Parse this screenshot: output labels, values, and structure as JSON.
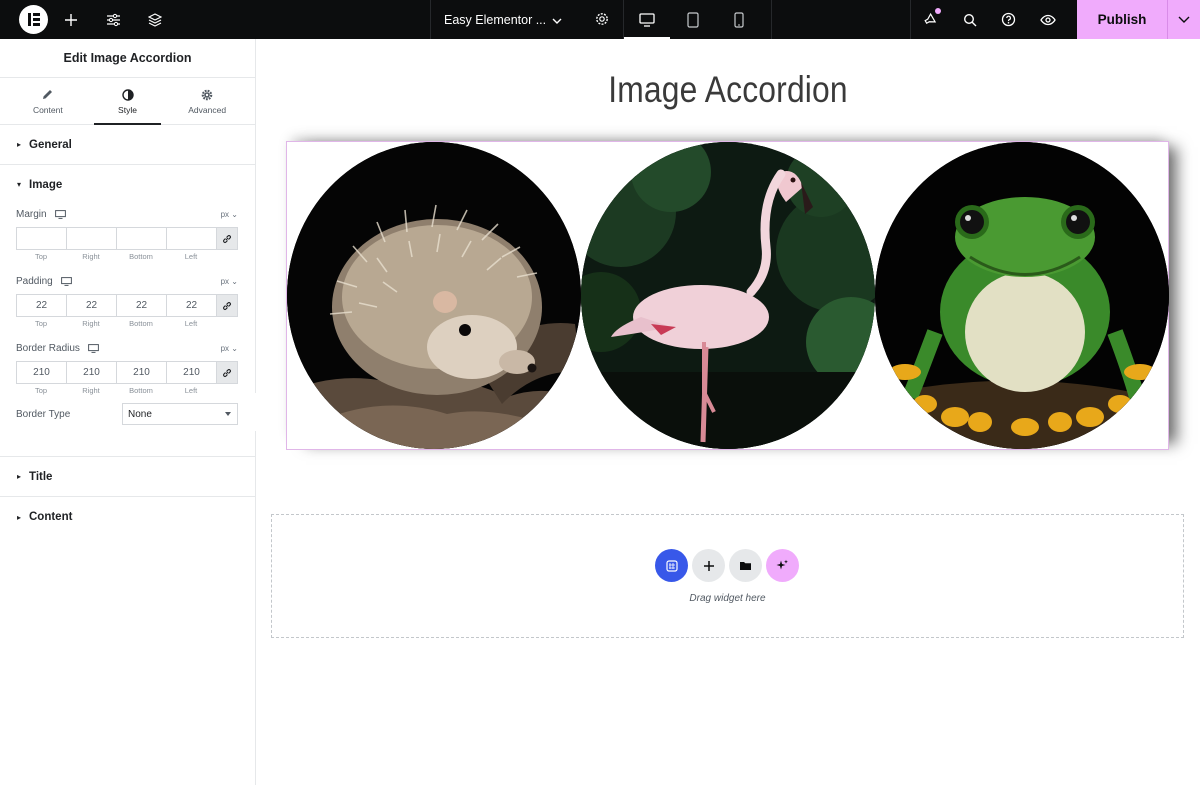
{
  "topbar": {
    "document_title": "Easy Elementor ...",
    "publish_label": "Publish",
    "accent_color": "#f0abfc"
  },
  "panel": {
    "title": "Edit Image Accordion",
    "tabs": [
      {
        "label": "Content",
        "icon": "pencil-icon"
      },
      {
        "label": "Style",
        "icon": "half-circle-icon"
      },
      {
        "label": "Advanced",
        "icon": "gear-icon"
      }
    ],
    "sections": {
      "general": "General",
      "image": "Image",
      "title": "Title",
      "content": "Content"
    },
    "image_controls": {
      "margin": {
        "label": "Margin",
        "unit": "px",
        "values": [
          "",
          "",
          "",
          ""
        ]
      },
      "padding": {
        "label": "Padding",
        "unit": "px",
        "values": [
          "22",
          "22",
          "22",
          "22"
        ]
      },
      "border_radius": {
        "label": "Border Radius",
        "unit": "px",
        "values": [
          "210",
          "210",
          "210",
          "210"
        ]
      },
      "side_labels": [
        "Top",
        "Right",
        "Bottom",
        "Left"
      ],
      "border_type": {
        "label": "Border Type",
        "value": "None"
      }
    }
  },
  "canvas": {
    "heading": "Image Accordion",
    "accordion_items": [
      {
        "subject": "hedgehog"
      },
      {
        "subject": "flamingo"
      },
      {
        "subject": "frog"
      }
    ],
    "dropzone_text": "Drag widget here"
  }
}
